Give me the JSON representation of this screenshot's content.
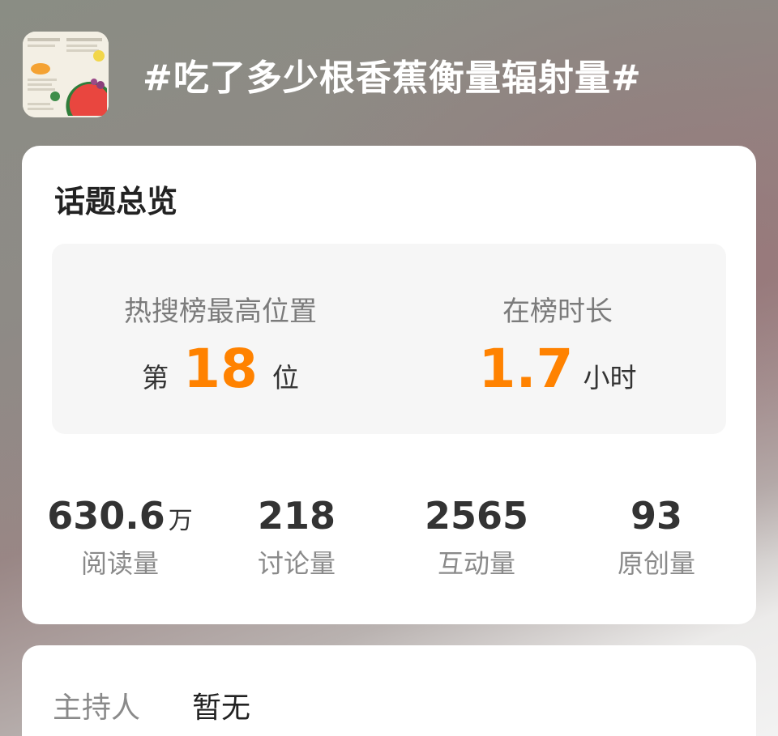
{
  "header": {
    "thumbnail_icon": "topic-cover-image",
    "title": "#吃了多少根香蕉衡量辐射量#"
  },
  "overview": {
    "title": "话题总览",
    "peak_rank": {
      "label": "热搜榜最高位置",
      "prefix": "第",
      "value": "18",
      "suffix": "位"
    },
    "duration": {
      "label": "在榜时长",
      "value": "1.7",
      "suffix": "小时"
    },
    "metrics": [
      {
        "value": "630.6",
        "suffix": "万",
        "label": "阅读量"
      },
      {
        "value": "218",
        "suffix": "",
        "label": "讨论量"
      },
      {
        "value": "2565",
        "suffix": "",
        "label": "互动量"
      },
      {
        "value": "93",
        "suffix": "",
        "label": "原创量"
      }
    ]
  },
  "host": {
    "label": "主持人",
    "value": "暂无"
  },
  "colors": {
    "accent": "#ff8200",
    "text_primary": "#222222",
    "text_secondary": "#8a8a8a",
    "panel_bg": "#f6f6f6"
  }
}
